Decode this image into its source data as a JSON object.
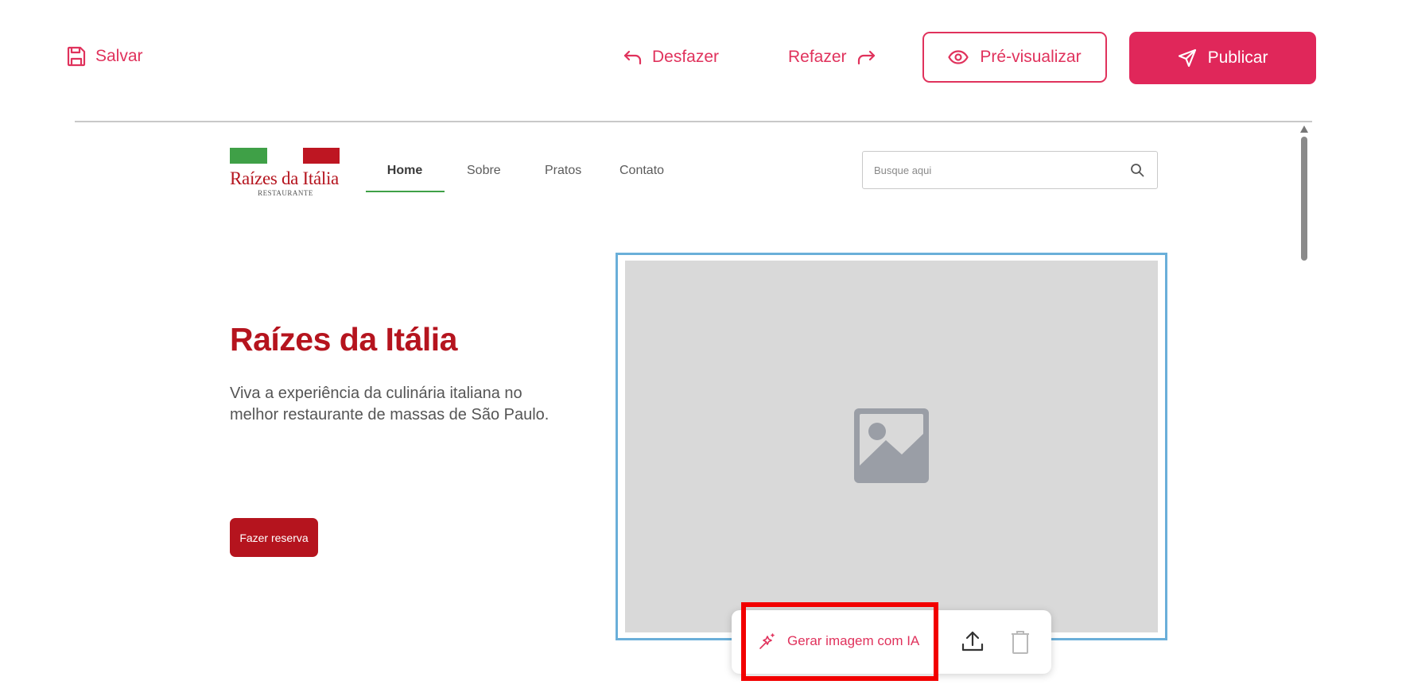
{
  "toolbar": {
    "save": "Salvar",
    "undo": "Desfazer",
    "redo": "Refazer",
    "preview": "Pré-visualizar",
    "publish": "Publicar"
  },
  "site": {
    "logo": {
      "name": "Raízes da Itália",
      "subtitle": "RESTAURANTE"
    },
    "nav": [
      "Home",
      "Sobre",
      "Pratos",
      "Contato"
    ],
    "search_placeholder": "Busque aqui",
    "hero": {
      "title": "Raízes da Itália",
      "description": "Viva a experiência da culinária italiana no melhor restaurante de massas de São Paulo.",
      "cta": "Fazer reserva"
    }
  },
  "image_toolbar": {
    "generate_ai": "Gerar imagem com IA"
  },
  "colors": {
    "editor_accent": "#e0325c",
    "brand_red": "#b5141e",
    "brand_green": "#3fa047",
    "selection_blue": "#6aafd9",
    "highlight": "#f20000"
  },
  "icons": [
    "save-icon",
    "undo-icon",
    "redo-icon",
    "eye-icon",
    "send-icon",
    "search-icon",
    "image-placeholder-icon",
    "sparkle-icon",
    "upload-icon",
    "trash-icon"
  ]
}
